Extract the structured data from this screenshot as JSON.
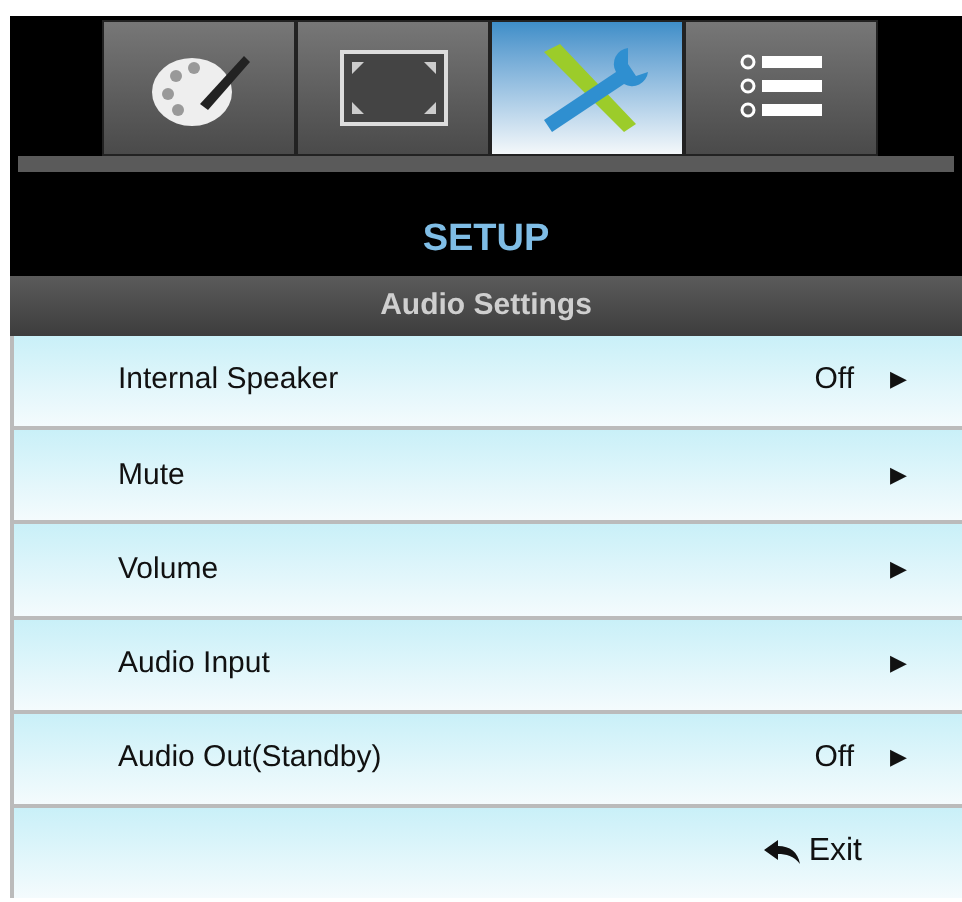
{
  "tabs": [
    {
      "kind": "palette",
      "selected": false
    },
    {
      "kind": "display",
      "selected": false
    },
    {
      "kind": "tools",
      "selected": true
    },
    {
      "kind": "list",
      "selected": false
    }
  ],
  "title": "SETUP",
  "subtitle": "Audio Settings",
  "items": [
    {
      "label": "Internal Speaker",
      "value": "Off",
      "arrow": "▶"
    },
    {
      "label": "Mute",
      "arrow": "▶"
    },
    {
      "label": "Volume",
      "arrow": "▶"
    },
    {
      "label": "Audio Input",
      "arrow": "▶"
    },
    {
      "label": "Audio Out(Standby)",
      "value": "Off",
      "arrow": "▶"
    }
  ],
  "exit": {
    "label": "Exit"
  }
}
